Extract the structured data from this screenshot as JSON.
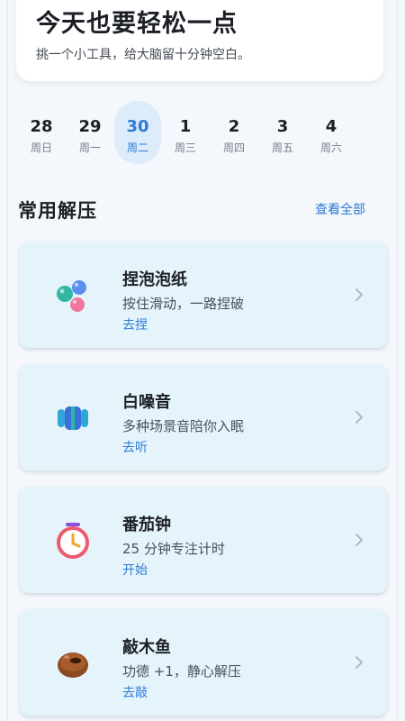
{
  "hero": {
    "title": "今天也要轻松一点",
    "subtitle": "挑一个小工具，给大脑留十分钟空白。"
  },
  "dates": [
    {
      "day": "28",
      "weekday": "周日",
      "active": false
    },
    {
      "day": "29",
      "weekday": "周一",
      "active": false
    },
    {
      "day": "30",
      "weekday": "周二",
      "active": true
    },
    {
      "day": "1",
      "weekday": "周三",
      "active": false
    },
    {
      "day": "2",
      "weekday": "周四",
      "active": false
    },
    {
      "day": "3",
      "weekday": "周五",
      "active": false
    },
    {
      "day": "4",
      "weekday": "周六",
      "active": false
    }
  ],
  "section": {
    "title": "常用解压",
    "view_all": "查看全部"
  },
  "cards": [
    {
      "title": "捏泡泡纸",
      "desc": "按住滑动，一路捏破",
      "action": "去捏",
      "icon": "bubbles-icon"
    },
    {
      "title": "白噪音",
      "desc": "多种场景音陪你入眠",
      "action": "去听",
      "icon": "headphones-icon"
    },
    {
      "title": "番茄钟",
      "desc": "25 分钟专注计时",
      "action": "开始",
      "icon": "timer-icon"
    },
    {
      "title": "敲木鱼",
      "desc": "功德 +1，静心解压",
      "action": "去敲",
      "icon": "wooden-fish-icon"
    }
  ],
  "colors": {
    "accent": "#2d7ad6",
    "card_bg": "#e5f4fb",
    "active_date_bg": "#dcecfb"
  }
}
